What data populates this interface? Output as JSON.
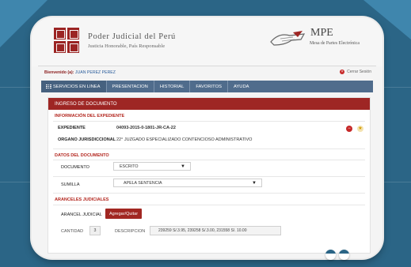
{
  "header": {
    "title": "Poder Judicial del Perú",
    "subtitle": "Justicia Honorable, País Responsable",
    "mpe_title": "MPE",
    "mpe_subtitle": "Mesa de Partes Electrónica"
  },
  "welcome": {
    "label": "Bienvenido (a):",
    "user": "JUAN PEREZ PEREZ",
    "logout": "Cerrar Sesión"
  },
  "nav": {
    "items": [
      "SERVICIOS EN LINEA",
      "PRESENTACION",
      "HISTORIAL",
      "FAVORITOS",
      "AYUDA"
    ]
  },
  "panel": {
    "title": "INGRESO DE DOCUMENTO",
    "info_title": "INFORMACIÓN DEL EXPEDIENTE",
    "expediente_label": "EXPEDIENTE",
    "expediente_value": "04093-2015-0-1801-JR-CA-22",
    "organo_label": "ORGANO JURISDICCIONAL",
    "organo_value": "22° JUZGADO ESPECIALIZADO CONTENCIOSO ADMINISTRATIVO",
    "datos_title": "DATOS DEL DOCUMENTO",
    "documento_label": "DOCUMENTO",
    "documento_value": "ESCRITO",
    "sumilla_label": "SUMILLA",
    "sumilla_value": "APELA SENTENCIA",
    "aranceles_title": "ARANCELES JUDICIALES",
    "arancel_label": "ARANCEL JUDICIAL",
    "arancel_button": "Agregar/Quitar",
    "cantidad_label": "CANTIDAD",
    "cantidad_value": "3",
    "descripcion_label": "DESCRIPCION",
    "descripcion_value": "239259 S/.3.95, 239258 S/.3.00, 231558 S/. 10.00"
  },
  "colors": {
    "background": "#2b6586",
    "brand_red": "#9e2624",
    "navbar": "#506c8c"
  },
  "icons": {
    "remove": "minus-circle-icon",
    "favorite": "star-icon",
    "logout": "close-circle-icon",
    "menu": "grid-icon"
  }
}
